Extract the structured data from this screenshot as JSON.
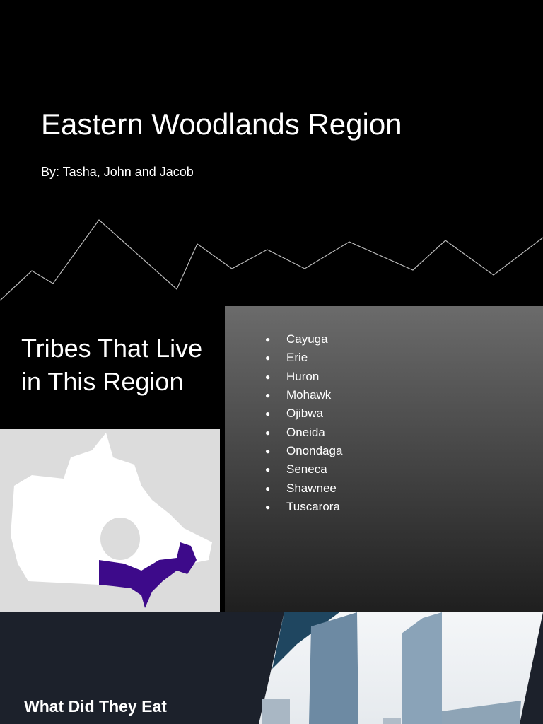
{
  "slide1": {
    "title": "Eastern Woodlands Region",
    "byline": "By: Tasha, John and Jacob"
  },
  "slide2": {
    "heading": "Tribes That Live in This Region",
    "tribes": [
      "Cayuga",
      "Erie",
      "Huron",
      "Mohawk",
      "Ojibwa",
      "Oneida",
      "Onondaga",
      "Seneca",
      "Shawnee",
      "Tuscarora"
    ],
    "bullet": "●",
    "region_color": "#3d0a8a"
  },
  "slide3": {
    "heading": "What Did They Eat"
  }
}
